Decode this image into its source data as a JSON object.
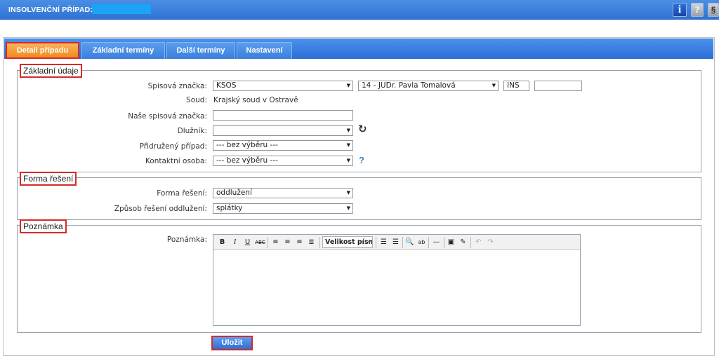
{
  "header": {
    "title": "INSOLVENČNÍ PŘÍPAD:",
    "info_icon": "info-icon",
    "help_icon": "?",
    "s_icon": "§"
  },
  "tabs": [
    {
      "label": "Detail případu",
      "active": true
    },
    {
      "label": "Základní termíny",
      "active": false
    },
    {
      "label": "Další termíny",
      "active": false
    },
    {
      "label": "Nastavení",
      "active": false
    }
  ],
  "zakladni": {
    "legend": "Základní údaje",
    "spisova_label": "Spisová značka:",
    "spisova_value": "KSOS",
    "senat_value": "14 - JUDr. Pavla Tomalová",
    "ins_value": "INS",
    "cislo_value": "",
    "soud_label": "Soud:",
    "soud_value": "Krajský soud v Ostravě",
    "nase_label": "Naše spisová značka:",
    "nase_value": "",
    "dluznik_label": "Dlužník:",
    "dluznik_value": "",
    "pridruzeny_label": "Přidružený případ:",
    "pridruzeny_value": "--- bez výběru ---",
    "kontakt_label": "Kontaktní osoba:",
    "kontakt_value": "--- bez výběru ---",
    "help_glyph": "?"
  },
  "forma": {
    "legend": "Forma řešení",
    "forma_label": "Forma řešení:",
    "forma_value": "oddlužení",
    "zpusob_label": "Způsob řešení oddlužení:",
    "zpusob_value": "splátky"
  },
  "poznamka": {
    "legend": "Poznámka",
    "label": "Poznámka:",
    "font_size_value": "Velikost písma",
    "content": ""
  },
  "save_label": "Uložit",
  "colors": {
    "accent": "#2f74d4",
    "active_tab": "#ef8a1e",
    "highlight": "#d42a2a"
  }
}
